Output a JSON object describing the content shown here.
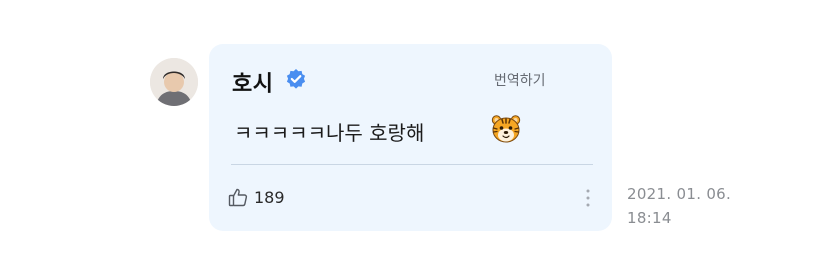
{
  "comment": {
    "author_name": "호시",
    "verified_icon": "verified-check-icon",
    "translate_label": "번역하기",
    "message_text": "ㅋㅋㅋㅋㅋ나두 호랑해",
    "emoji_icon": "tiger-face-emoji",
    "like_icon": "thumbs-up-icon",
    "like_count": "189",
    "more_icon": "more-vertical-icon",
    "date_line1": "2021. 01. 06.",
    "date_line2": "18:14"
  },
  "colors": {
    "card_background": "#eef6fe",
    "verified_blue": "#4a8ef0",
    "tiger_orange": "#f5a623"
  }
}
